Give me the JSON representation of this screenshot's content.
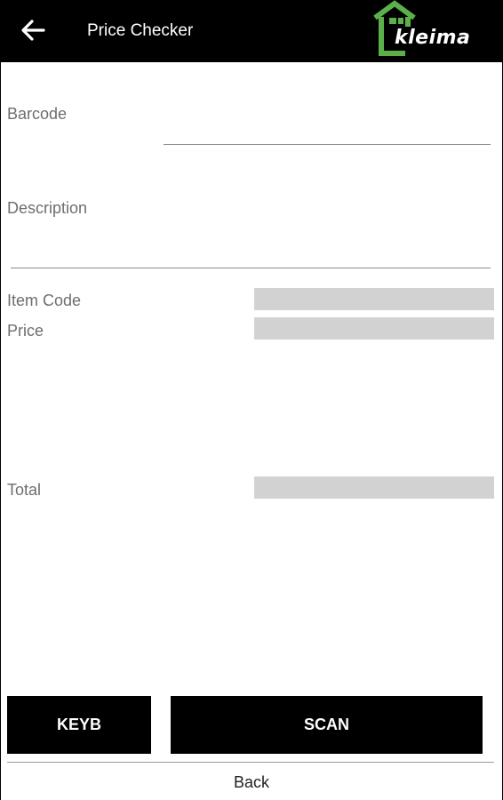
{
  "header": {
    "title": "Price Checker",
    "logo_text": "kleima",
    "back_icon": "back-arrow-icon",
    "logo_icon": "house-logo-icon",
    "colors": {
      "bar": "#000000",
      "logo_green": "#5cb04a",
      "text": "#ffffff"
    }
  },
  "form": {
    "barcode_label": "Barcode",
    "barcode_value": "",
    "description_label": "Description",
    "description_value": "",
    "item_code_label": "Item Code",
    "item_code_value": "",
    "price_label": "Price",
    "price_value": "",
    "total_label": "Total",
    "total_value": ""
  },
  "buttons": {
    "keyboard_label": "KEYB",
    "scan_label": "SCAN"
  },
  "footer": {
    "back_label": "Back"
  }
}
